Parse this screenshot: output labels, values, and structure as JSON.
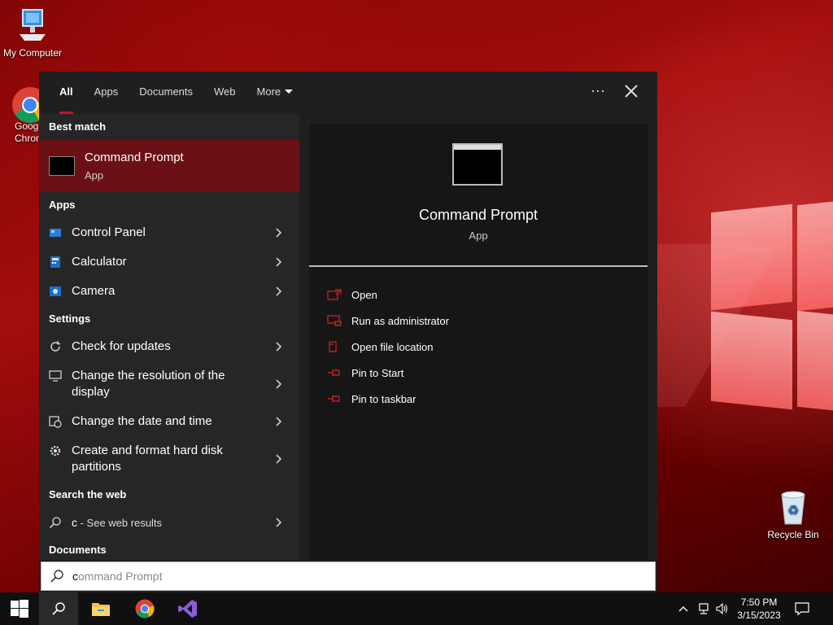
{
  "desktop": {
    "icons": [
      {
        "label": "My Computer"
      },
      {
        "label": "Google Chrome"
      },
      {
        "label": "Recycle Bin"
      }
    ],
    "chrome_visible_text_1": "Goog",
    "chrome_visible_text_2": "Chron"
  },
  "search_panel": {
    "tabs": [
      {
        "label": "All"
      },
      {
        "label": "Apps"
      },
      {
        "label": "Documents"
      },
      {
        "label": "Web"
      },
      {
        "label": "More"
      }
    ],
    "more_icon": "ellipsis-icon",
    "close_icon": "close-icon",
    "best_match": {
      "heading": "Best match",
      "title": "Command Prompt",
      "subtitle": "App"
    },
    "apps": {
      "heading": "Apps",
      "items": [
        {
          "label": "Control Panel",
          "icon": "control-panel-icon"
        },
        {
          "label": "Calculator",
          "icon": "calculator-icon"
        },
        {
          "label": "Camera",
          "icon": "camera-icon"
        }
      ]
    },
    "settings": {
      "heading": "Settings",
      "items": [
        {
          "label": "Check for updates",
          "icon": "refresh-icon"
        },
        {
          "label": "Change the resolution of the display",
          "icon": "monitor-icon"
        },
        {
          "label": "Change the date and time",
          "icon": "calendar-clock-icon"
        },
        {
          "label": "Create and format hard disk partitions",
          "icon": "gear-icon"
        }
      ]
    },
    "web": {
      "heading": "Search the web",
      "query": "c",
      "suffix": " - See web results"
    },
    "documents": {
      "heading": "Documents"
    },
    "preview": {
      "title": "Command Prompt",
      "subtitle": "App",
      "actions": [
        {
          "label": "Open",
          "icon": "open-icon"
        },
        {
          "label": "Run as administrator",
          "icon": "run-admin-icon"
        },
        {
          "label": "Open file location",
          "icon": "folder-location-icon"
        },
        {
          "label": "Pin to Start",
          "icon": "pin-icon"
        },
        {
          "label": "Pin to taskbar",
          "icon": "pin-icon"
        }
      ]
    },
    "search_box": {
      "typed": "c",
      "completion": "ommand Prompt"
    }
  },
  "taskbar": {
    "time": "7:50 PM",
    "date": "3/15/2023"
  },
  "colors": {
    "accent": "#c8102e",
    "best_match_bg": "#6b1014",
    "panel_bg": "#1f1f1f"
  }
}
